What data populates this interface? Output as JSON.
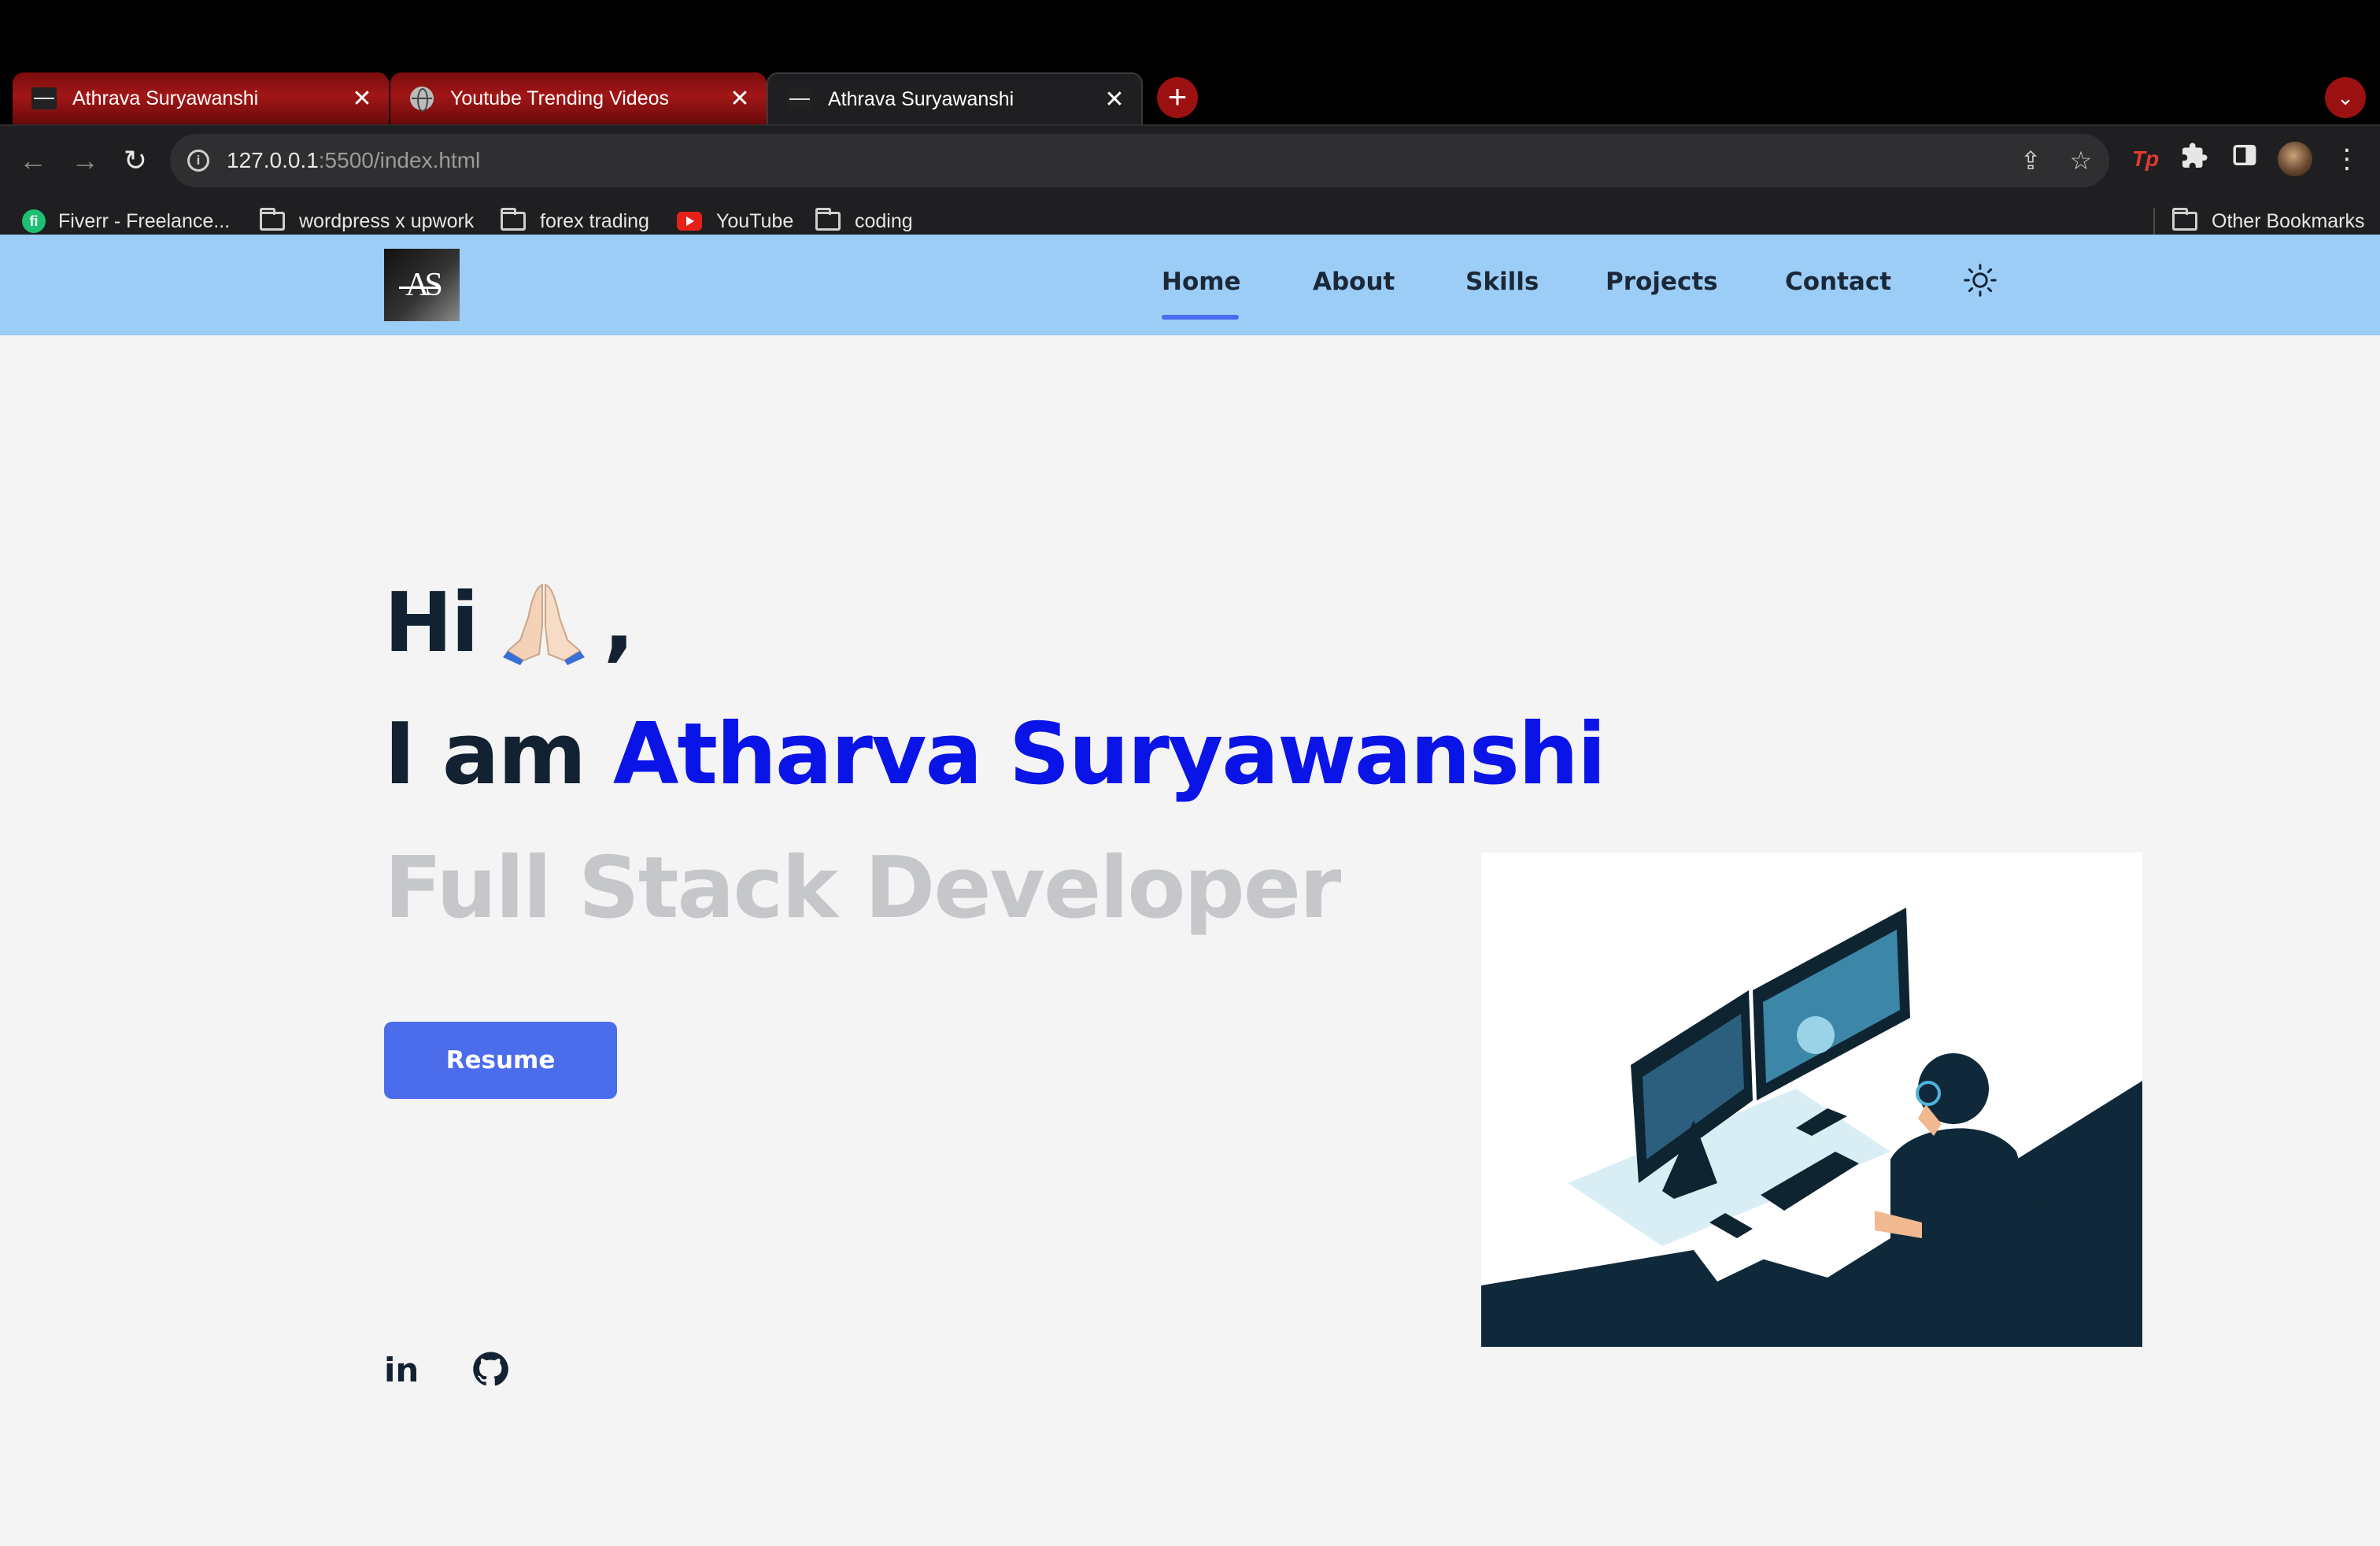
{
  "browser": {
    "tabs": [
      {
        "title": "Athrava Suryawanshi",
        "active": false
      },
      {
        "title": "Youtube Trending Videos",
        "active": false
      },
      {
        "title": "Athrava Suryawanshi",
        "active": true
      }
    ],
    "close_glyph": "✕",
    "new_tab_glyph": "+",
    "tab_menu_glyph": "⌄",
    "url_host": "127.0.0.1",
    "url_rest": ":5500/index.html",
    "bookmarks": [
      {
        "label": "Fiverr - Freelance...",
        "icon": "fiverr-icon"
      },
      {
        "label": "wordpress x upwork",
        "icon": "folder-icon"
      },
      {
        "label": "forex trading",
        "icon": "folder-icon"
      },
      {
        "label": "YouTube",
        "icon": "youtube-icon"
      },
      {
        "label": "coding",
        "icon": "folder-icon"
      }
    ],
    "other_bookmarks": "Other Bookmarks",
    "extension_badge": "Tp"
  },
  "site": {
    "logo_text": "AS",
    "nav": [
      {
        "label": "Home",
        "active": true
      },
      {
        "label": "About"
      },
      {
        "label": "Skills"
      },
      {
        "label": "Projects"
      },
      {
        "label": "Contact"
      }
    ],
    "theme_toggle_icon": "sun-icon",
    "hero": {
      "greeting": "Hi",
      "greeting_suffix": ",",
      "iam": "I am",
      "name": "Atharva Suryawanshi",
      "role": "Full Stack Developer",
      "resume_label": "Resume"
    },
    "social": {
      "linkedin_text": "in"
    },
    "colors": {
      "header_bg": "#9bcdf7",
      "accent": "#4b6ceb",
      "name": "#0b14e6",
      "role": "#c5c7ca",
      "text": "#132232"
    }
  }
}
